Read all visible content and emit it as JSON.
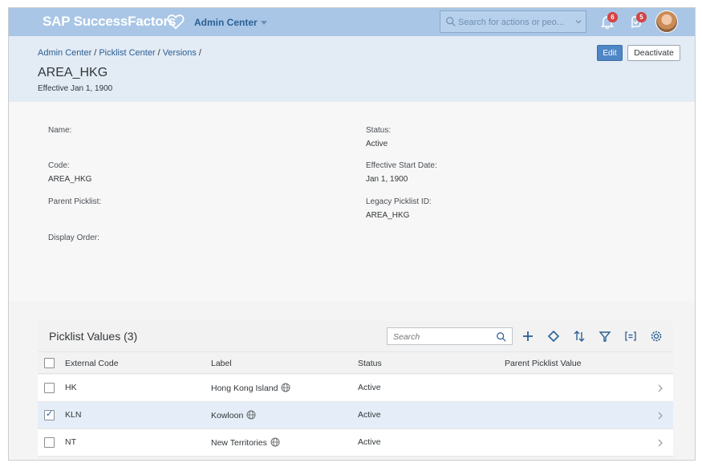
{
  "shell": {
    "brand": "SAP SuccessFactors",
    "admin_menu": "Admin Center",
    "search_placeholder": "Search for actions or peo...",
    "bell_badge": "6",
    "notif_badge": "5",
    "icons": [
      "heart-icon",
      "search-icon",
      "chevron-down-icon",
      "bell-icon",
      "notification-icon",
      "avatar"
    ]
  },
  "header": {
    "breadcrumb": [
      "Admin Center",
      "Picklist Center",
      "Versions"
    ],
    "breadcrumb_sep": "/",
    "title": "AREA_HKG",
    "subtitle": "Effective Jan 1, 1900",
    "edit_label": "Edit",
    "deactivate_label": "Deactivate"
  },
  "details": {
    "name_label": "Name:",
    "code_label": "Code:",
    "code_value": "AREA_HKG",
    "parent_label": "Parent Picklist:",
    "display_order_label": "Display Order:",
    "status_label": "Status:",
    "status_value": "Active",
    "start_date_label": "Effective Start Date:",
    "start_date_value": "Jan 1, 1900",
    "legacy_label": "Legacy Picklist ID:",
    "legacy_value": "AREA_HKG"
  },
  "table": {
    "title": "Picklist Values (3)",
    "search_placeholder": "Search",
    "toolbar_icons": [
      "search-icon",
      "add-icon",
      "diamond-icon",
      "sort-icon",
      "filter-icon",
      "group-icon",
      "settings-icon"
    ],
    "columns": [
      "External Code",
      "Label",
      "Status",
      "Parent Picklist Value"
    ],
    "rows": [
      {
        "code": "HK",
        "label": "Hong Kong Island",
        "status": "Active",
        "parent": "",
        "selected": false
      },
      {
        "code": "KLN",
        "label": "Kowloon",
        "status": "Active",
        "parent": "",
        "selected": true
      },
      {
        "code": "NT",
        "label": "New Territories",
        "status": "Active",
        "parent": "",
        "selected": false
      }
    ]
  },
  "colors": {
    "shell_bg": "#a9c6e6",
    "header_bg": "#e3ebf4",
    "link": "#2a5f95",
    "edit_button": "#4f86c6",
    "badge": "#d44343",
    "selected_row": "#e5eef8"
  }
}
